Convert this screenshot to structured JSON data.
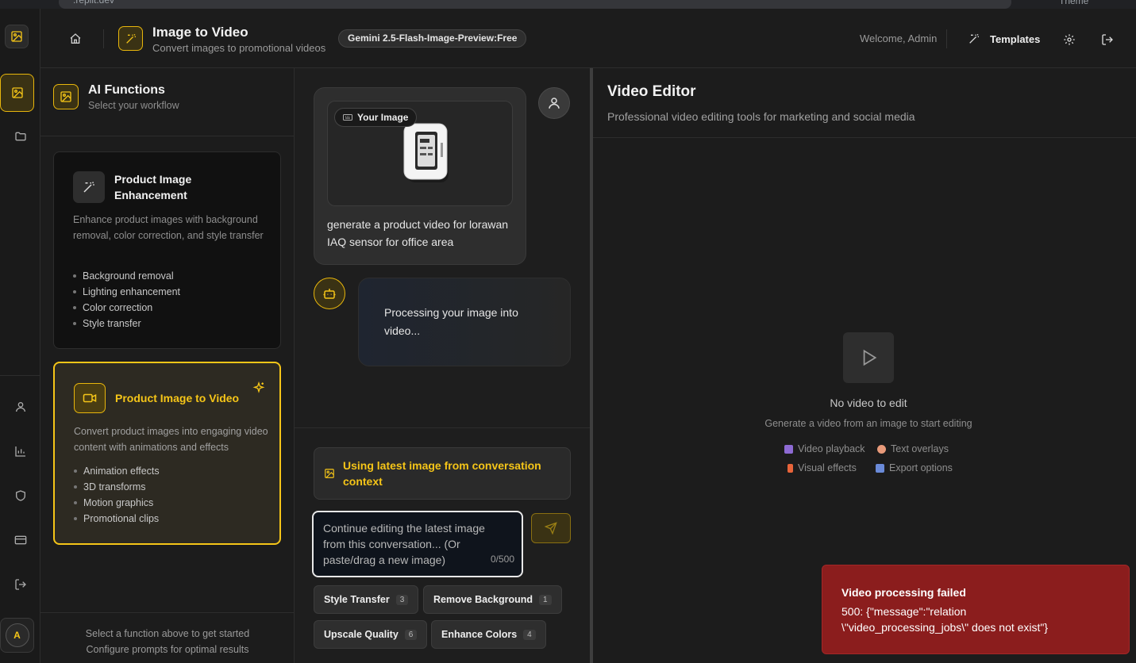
{
  "browser": {
    "url": ".replit.dev",
    "theme_label": "Theme"
  },
  "header": {
    "title": "Image to Video",
    "subtitle": "Convert images to promotional videos",
    "model_badge": "Gemini 2.5-Flash-Image-Preview:Free",
    "welcome": "Welcome, Admin",
    "templates_label": "Templates"
  },
  "rail": {
    "avatar_initial": "A",
    "icons": [
      "image-icon",
      "folder-icon",
      "user-icon",
      "chart-icon",
      "shield-icon",
      "card-icon",
      "logout-icon"
    ]
  },
  "functions": {
    "title": "AI Functions",
    "subtitle": "Select your workflow",
    "cards": [
      {
        "title": "Product Image Enhancement",
        "description": "Enhance product images with background removal, color correction, and style transfer",
        "features": [
          "Background removal",
          "Lighting enhancement",
          "Color correction",
          "Style transfer"
        ],
        "selected": false
      },
      {
        "title": "Product Image to Video",
        "description": "Convert product images into engaging video content with animations and effects",
        "features": [
          "Animation effects",
          "3D transforms",
          "Motion graphics",
          "Promotional clips"
        ],
        "selected": true
      }
    ],
    "footer_line1": "Select a function above to get started",
    "footer_line2": "Configure prompts for optimal results"
  },
  "chat": {
    "image_tag": "Your Image",
    "user_message": "generate a product video for lorawan IAQ sensor for office area",
    "bot_message": "Processing your image into video...",
    "context_banner": "Using latest image from conversation context",
    "input_placeholder": "Continue editing the latest image from this conversation... (Or paste/drag a new image)",
    "char_count": "0/500",
    "chips": [
      {
        "label": "Style Transfer",
        "count": "3"
      },
      {
        "label": "Remove Background",
        "count": "1"
      },
      {
        "label": "Upscale Quality",
        "count": "6"
      },
      {
        "label": "Enhance Colors",
        "count": "4"
      }
    ]
  },
  "editor": {
    "title": "Video Editor",
    "subtitle": "Professional video editing tools for marketing and social media",
    "empty_title": "No video to edit",
    "empty_subtitle": "Generate a video from an image to start editing",
    "features": [
      "Video playback",
      "Text overlays",
      "Visual effects",
      "Export options"
    ]
  },
  "toast": {
    "title": "Video processing failed",
    "message": "500: {\"message\":\"relation \\\"video_processing_jobs\\\" does not exist\"}"
  },
  "colors": {
    "accent": "#f5c518",
    "toast_bg": "#8b1d1d",
    "background": "#1c1c1c"
  }
}
